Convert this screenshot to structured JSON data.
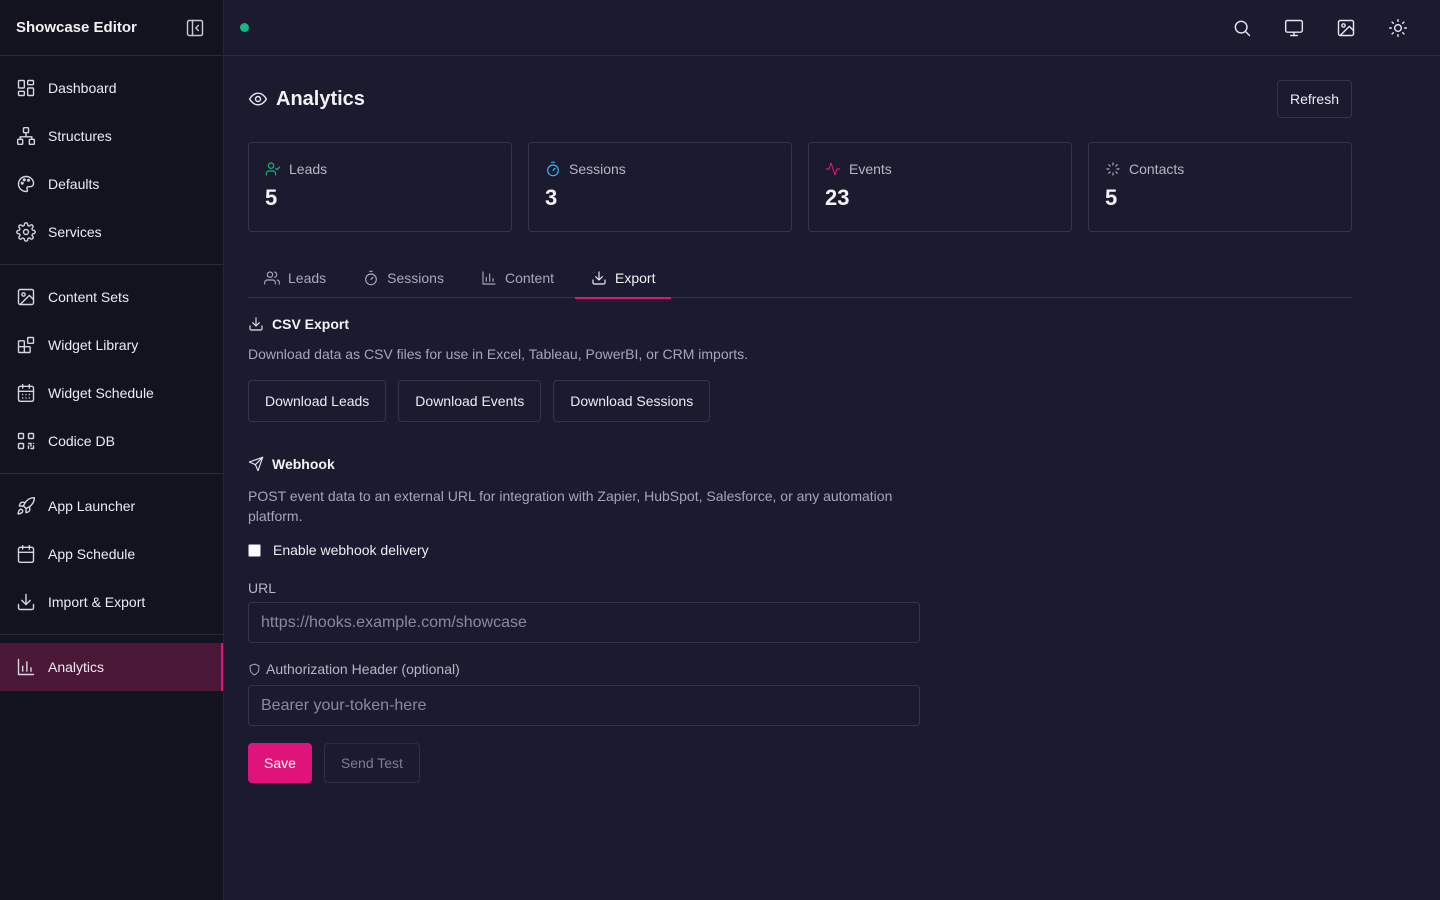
{
  "app": {
    "title": "Showcase Editor",
    "status_color": "#10b981",
    "accent": "#e0137a"
  },
  "sidebar": {
    "groups": [
      [
        {
          "label": "Dashboard",
          "icon": "grid-icon"
        },
        {
          "label": "Structures",
          "icon": "sitemap-icon"
        },
        {
          "label": "Defaults",
          "icon": "palette-icon"
        },
        {
          "label": "Services",
          "icon": "gear-icon"
        }
      ],
      [
        {
          "label": "Content Sets",
          "icon": "image-icon"
        },
        {
          "label": "Widget Library",
          "icon": "widgets-icon"
        },
        {
          "label": "Widget Schedule",
          "icon": "calendar-grid-icon"
        },
        {
          "label": "Codice DB",
          "icon": "qr-icon"
        }
      ],
      [
        {
          "label": "App Launcher",
          "icon": "rocket-icon"
        },
        {
          "label": "App Schedule",
          "icon": "calendar-icon"
        },
        {
          "label": "Import & Export",
          "icon": "download-icon"
        }
      ],
      [
        {
          "label": "Analytics",
          "icon": "bar-chart-icon",
          "active": true
        }
      ]
    ]
  },
  "topbar": {
    "icons": [
      "search-icon",
      "monitor-icon",
      "image-icon",
      "sun-icon"
    ]
  },
  "page": {
    "title": "Analytics",
    "refresh_label": "Refresh"
  },
  "stats": [
    {
      "label": "Leads",
      "value": "5",
      "icon": "user-check-icon",
      "color": "#10b981"
    },
    {
      "label": "Sessions",
      "value": "3",
      "icon": "timer-icon",
      "color": "#38bdf8"
    },
    {
      "label": "Events",
      "value": "23",
      "icon": "activity-icon",
      "color": "#e0137a"
    },
    {
      "label": "Contacts",
      "value": "5",
      "icon": "sparkle-icon",
      "color": "#b6b6c6"
    }
  ],
  "tabs": [
    {
      "label": "Leads",
      "icon": "users-icon"
    },
    {
      "label": "Sessions",
      "icon": "timer-icon"
    },
    {
      "label": "Content",
      "icon": "bar-chart-icon"
    },
    {
      "label": "Export",
      "icon": "download-icon",
      "active": true
    }
  ],
  "csv": {
    "title": "CSV Export",
    "description": "Download data as CSV files for use in Excel, Tableau, PowerBI, or CRM imports.",
    "buttons": [
      "Download Leads",
      "Download Events",
      "Download Sessions"
    ]
  },
  "webhook": {
    "title": "Webhook",
    "description": "POST event data to an external URL for integration with Zapier, HubSpot, Salesforce, or any automation platform.",
    "enable_label": "Enable webhook delivery",
    "enabled": false,
    "url_label": "URL",
    "url_placeholder": "https://hooks.example.com/showcase",
    "url_value": "",
    "auth_label": "Authorization Header (optional)",
    "auth_placeholder": "Bearer your-token-here",
    "auth_value": "",
    "save_label": "Save",
    "test_label": "Send Test"
  }
}
